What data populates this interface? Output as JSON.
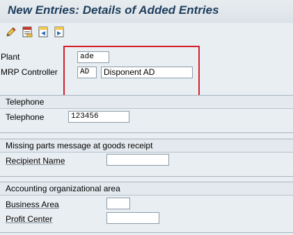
{
  "header": {
    "title": "New Entries: Details of Added Entries"
  },
  "toolbar": {
    "buttons": [
      {
        "icon": "edit-pencil-icon"
      },
      {
        "icon": "delete-icon"
      },
      {
        "icon": "previous-entry-icon"
      },
      {
        "icon": "next-entry-icon"
      }
    ]
  },
  "main": {
    "plant": {
      "label": "Plant",
      "value": "ade"
    },
    "mrp_controller": {
      "label": "MRP Controller",
      "value": "AD",
      "description": "Disponent AD"
    }
  },
  "telephone_group": {
    "title": "Telephone",
    "telephone": {
      "label": "Telephone",
      "value": "123456"
    }
  },
  "missing_parts_group": {
    "title": "Missing parts message at goods receipt",
    "recipient": {
      "label": "Recipient Name",
      "value": ""
    }
  },
  "accounting_group": {
    "title": "Accounting organizational area",
    "business_area": {
      "label": "Business Area",
      "value": ""
    },
    "profit_center": {
      "label": "Profit Center",
      "value": ""
    }
  },
  "colors": {
    "title": "#1e3e5c",
    "highlight": "#d21f2b",
    "background": "#e9eef2"
  }
}
